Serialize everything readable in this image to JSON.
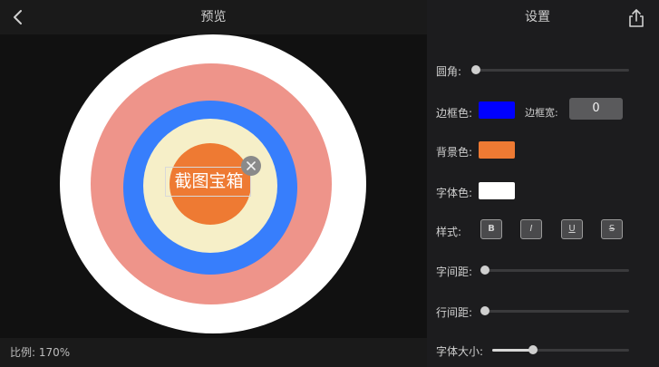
{
  "preview": {
    "title": "预览",
    "text": "截图宝箱",
    "scale_label": "比例: 170%",
    "rings": [
      "#ffffff",
      "#ee948a",
      "#377efc",
      "#f6efc8",
      "#ee7a33"
    ]
  },
  "settings": {
    "title": "设置",
    "corner_radius": {
      "label": "圆角:",
      "value": 0
    },
    "border_color": {
      "label": "边框色:",
      "color": "#0000ff"
    },
    "border_width": {
      "label": "边框宽:",
      "value": "0"
    },
    "background_color": {
      "label": "背景色:",
      "color": "#ee7a33"
    },
    "font_color": {
      "label": "字体色:",
      "color": "#ffffff"
    },
    "style": {
      "label": "样式:",
      "buttons": [
        "B",
        "I",
        "U",
        "S"
      ]
    },
    "letter_spacing": {
      "label": "字间距:",
      "value": 0
    },
    "line_spacing": {
      "label": "行间距:",
      "value": 0
    },
    "font_size": {
      "label": "字体大小:",
      "value": 0.3
    }
  },
  "icons": {
    "back": "chevron-left-icon",
    "share": "share-icon",
    "close": "close-icon"
  }
}
